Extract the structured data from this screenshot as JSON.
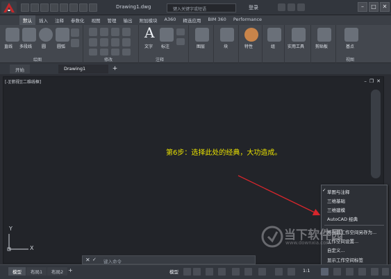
{
  "titlebar": {
    "drawing_title": "Drawing1.dwg",
    "search_placeholder": "键入关键字或短语",
    "login": "登录"
  },
  "ribbon_tabs": [
    "默认",
    "插入",
    "注释",
    "参数化",
    "视图",
    "管理",
    "输出",
    "附加模块",
    "A360",
    "精选应用",
    "BIM 360",
    "Performance"
  ],
  "ribbon": {
    "draw_tools": [
      "直线",
      "多段线",
      "圆",
      "圆弧"
    ],
    "text_label": "文字",
    "dimension_label": "标注",
    "layers_label": "图层",
    "block_label": "块",
    "properties_label": "特性",
    "group_label": "组",
    "utilities_label": "实用工具",
    "clipboard_label": "剪贴板",
    "base_label": "基点",
    "panels": {
      "draw": "绘图",
      "modify": "修改",
      "annotation": "注释",
      "view": "视图"
    }
  },
  "file_tabs": {
    "start": "开始",
    "drawing": "Drawing1"
  },
  "viewport": {
    "label": "[-][俯视][二维线框]",
    "caption": "第6步：选择此处的经典，大功造成。",
    "axis_x": "X",
    "axis_y": "Y"
  },
  "command_line": {
    "placeholder": "键入命令"
  },
  "workspace_menu": {
    "items": [
      "草图与注释",
      "三维基础",
      "三维建模",
      "AutoCAD 经典"
    ],
    "actions": [
      "将当前工作空间另存为...",
      "工作空间设置...",
      "自定义...",
      "显示工作空间标签"
    ],
    "checked_index": 0
  },
  "statusbar": {
    "layout_tabs": [
      "模型",
      "布局1",
      "布局2"
    ],
    "model_label": "模型",
    "scale": "1:1"
  },
  "watermark": {
    "brand": "当下软件园",
    "url": "www.downxia.com"
  },
  "colors": {
    "caption": "#e8e000",
    "app_logo": "#c0292b",
    "arrow": "#d8262c"
  }
}
